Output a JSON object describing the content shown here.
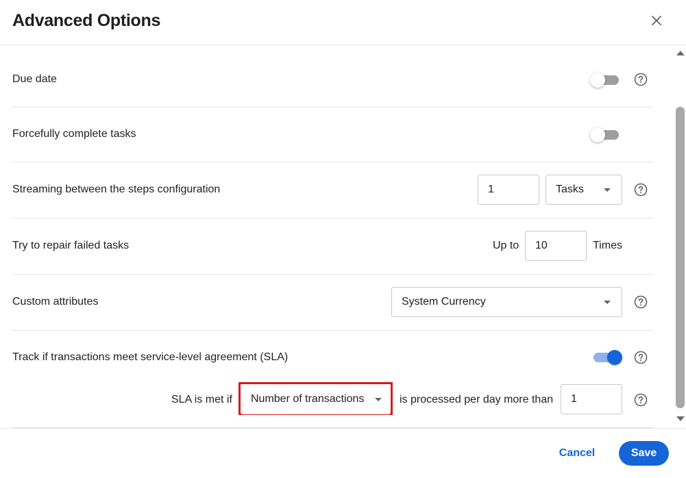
{
  "dialog": {
    "title": "Advanced Options",
    "close_icon": "close-icon"
  },
  "rows": {
    "due_date": {
      "label": "Due date",
      "toggle_on": false
    },
    "forcefully_complete": {
      "label": "Forcefully complete tasks",
      "toggle_on": false
    },
    "streaming": {
      "label": "Streaming between the steps configuration",
      "value": "1",
      "unit_selected": "Tasks"
    },
    "repair": {
      "label": "Try to repair failed tasks",
      "prefix": "Up to",
      "value": "10",
      "suffix": "Times"
    },
    "custom_attributes": {
      "label": "Custom attributes",
      "selected": "System Currency"
    },
    "sla": {
      "label": "Track if transactions meet service-level agreement (SLA)",
      "toggle_on": true,
      "condition_prefix": "SLA is met if",
      "metric_selected": "Number of transactions",
      "condition_middle": "is processed per day more than",
      "threshold": "1"
    }
  },
  "footer": {
    "cancel_label": "Cancel",
    "save_label": "Save"
  },
  "colors": {
    "accent": "#1565d8",
    "highlight": "#d8181f",
    "divider": "#e3e3e3"
  },
  "icons": {
    "help": "help-circle-icon",
    "dropdown": "chevron-down-icon"
  }
}
